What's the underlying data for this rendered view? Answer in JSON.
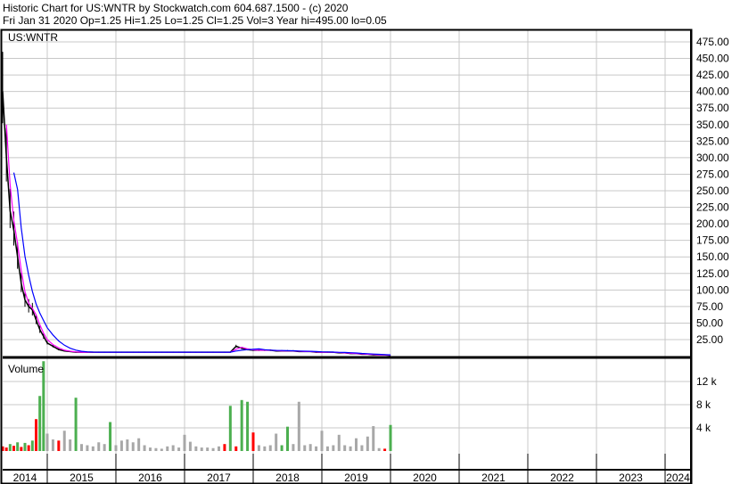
{
  "header": {
    "title": "Historic Chart for US:WNTR by Stockwatch.com 604.687.1500 - (c) 2020",
    "quote": "Fri Jan 31 2020  Op=1.25  Hi=1.25  Lo=1.25  Cl=1.25  Vol=3  Year hi=495.00  lo=0.05"
  },
  "colors": {
    "up": "#4caf50",
    "down": "#ff0000",
    "flat": "#a8a8a8",
    "ma_long": "#0000ff",
    "ma_short": "#ff00ff",
    "grid": "#c8c8c8"
  },
  "chart_data": [
    {
      "type": "line",
      "title": "US:WNTR",
      "ylim": [
        0,
        490
      ],
      "y_ticks": [
        "25.00",
        "50.00",
        "75.00",
        "100.00",
        "125.00",
        "150.00",
        "175.00",
        "200.00",
        "225.00",
        "250.00",
        "275.00",
        "300.00",
        "325.00",
        "350.00",
        "375.00",
        "400.00",
        "425.00",
        "450.00",
        "475.00"
      ],
      "x_tick_labels": [
        "2014",
        "2015",
        "2016",
        "2017",
        "2018",
        "2019",
        "2020",
        "2021",
        "2022",
        "2023",
        "2024"
      ],
      "x_start": "2014-01",
      "x_frequency": "monthly",
      "grid": true,
      "series": [
        {
          "name": "Close",
          "values": [
            400,
            300,
            220,
            190,
            150,
            110,
            85,
            75,
            70,
            55,
            40,
            30,
            20,
            15,
            10,
            8,
            7,
            6,
            6,
            6,
            6,
            6,
            6,
            6,
            6,
            6,
            6,
            6,
            6,
            6,
            6,
            6,
            6,
            6,
            6,
            6,
            6,
            6,
            6,
            6,
            6,
            6,
            6,
            6,
            6,
            15,
            12,
            10,
            9,
            9,
            9,
            9,
            8,
            8,
            8,
            8,
            7,
            7,
            7,
            6,
            6,
            6,
            6,
            5,
            5,
            4,
            4,
            3,
            3,
            2,
            2,
            2,
            1.25
          ]
        }
      ]
    },
    {
      "type": "bar",
      "title": "Volume",
      "ylim": [
        0,
        16
      ],
      "y_unit": "k",
      "y_ticks": [
        "4 k",
        "8 k",
        "12 k"
      ],
      "x_start": "2014-01",
      "x_frequency": "monthly",
      "values": [
        0.8,
        0.6,
        1.2,
        0.9,
        1.5,
        0.7,
        1.4,
        1.0,
        1.8,
        5.5,
        9.5,
        15.5,
        3.0,
        2.0,
        1.8,
        3.5,
        2.0,
        9.2,
        1.2,
        1.0,
        0.8,
        1.5,
        1.2,
        5.0,
        1.0,
        1.8,
        2.0,
        1.5,
        2.2,
        1.0,
        0.6,
        0.5,
        0.4,
        0.8,
        1.0,
        0.6,
        2.8,
        1.6,
        0.8,
        0.6,
        0.6,
        0.5,
        0.8,
        1.2,
        7.8,
        0.8,
        8.8,
        8.5,
        3.2,
        1.0,
        0.8,
        1.0,
        3.0,
        1.0,
        4.2,
        1.2,
        8.5,
        1.0,
        1.2,
        0.8,
        3.5,
        0.8,
        1.0,
        2.8,
        1.0,
        0.8,
        2.2,
        1.0,
        2.5,
        4.3,
        0.5,
        0.4,
        4.5
      ],
      "direction": [
        "d",
        "d",
        "u",
        "d",
        "u",
        "d",
        "u",
        "d",
        "u",
        "d",
        "u",
        "u",
        "f",
        "f",
        "d",
        "f",
        "f",
        "u",
        "f",
        "f",
        "f",
        "f",
        "f",
        "u",
        "f",
        "f",
        "f",
        "f",
        "f",
        "f",
        "f",
        "f",
        "f",
        "f",
        "f",
        "f",
        "f",
        "f",
        "f",
        "f",
        "f",
        "f",
        "f",
        "d",
        "u",
        "d",
        "u",
        "u",
        "d",
        "f",
        "f",
        "f",
        "f",
        "u",
        "u",
        "f",
        "f",
        "f",
        "f",
        "f",
        "f",
        "f",
        "f",
        "f",
        "f",
        "f",
        "f",
        "f",
        "f",
        "f",
        "f",
        "d",
        "u"
      ]
    }
  ]
}
